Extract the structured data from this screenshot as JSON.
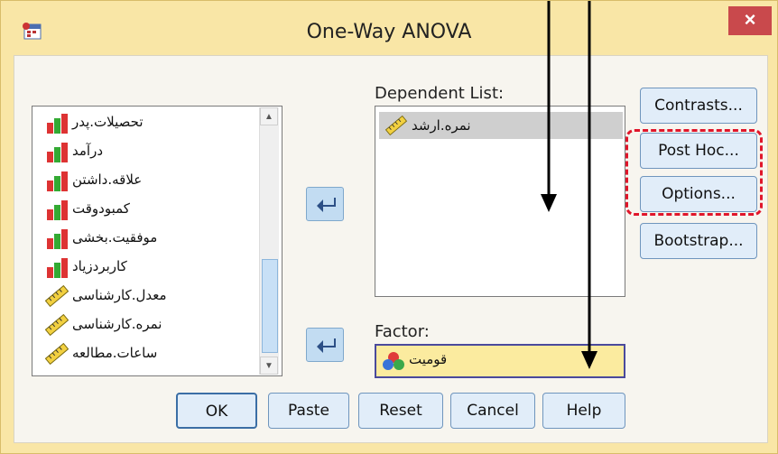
{
  "window": {
    "title": "One-Way ANOVA",
    "close_label": "×"
  },
  "source_list": {
    "items": [
      {
        "label": "تحصیلات.پدر",
        "icon": "nominal-bar-icon"
      },
      {
        "label": "درآمد",
        "icon": "nominal-bar-icon"
      },
      {
        "label": "علاقه.داشتن",
        "icon": "nominal-bar-icon"
      },
      {
        "label": "کمبودوقت",
        "icon": "nominal-bar-icon"
      },
      {
        "label": "موفقیت.بخشی",
        "icon": "nominal-bar-icon"
      },
      {
        "label": "کاربردزیاد",
        "icon": "nominal-bar-icon"
      },
      {
        "label": "معدل.کارشناسی",
        "icon": "scale-ruler-icon"
      },
      {
        "label": "نمره.کارشناسی",
        "icon": "scale-ruler-icon"
      },
      {
        "label": "ساعات.مطالعه",
        "icon": "scale-ruler-icon"
      }
    ]
  },
  "dependent": {
    "label": "Dependent List:",
    "items": [
      {
        "label": "نمره.ارشد",
        "icon": "scale-ruler-icon"
      }
    ]
  },
  "factor": {
    "label": "Factor:",
    "value": "قومیت",
    "icon": "nominal-circles-icon"
  },
  "side_buttons": {
    "contrasts": "Contrasts...",
    "post_hoc": "Post Hoc...",
    "options": "Options...",
    "bootstrap": "Bootstrap..."
  },
  "bottom_buttons": {
    "ok": "OK",
    "paste": "Paste",
    "reset": "Reset",
    "cancel": "Cancel",
    "help": "Help"
  },
  "colors": {
    "highlight_dash": "#e0162b",
    "dialog_bg": "#f9e6a6"
  }
}
